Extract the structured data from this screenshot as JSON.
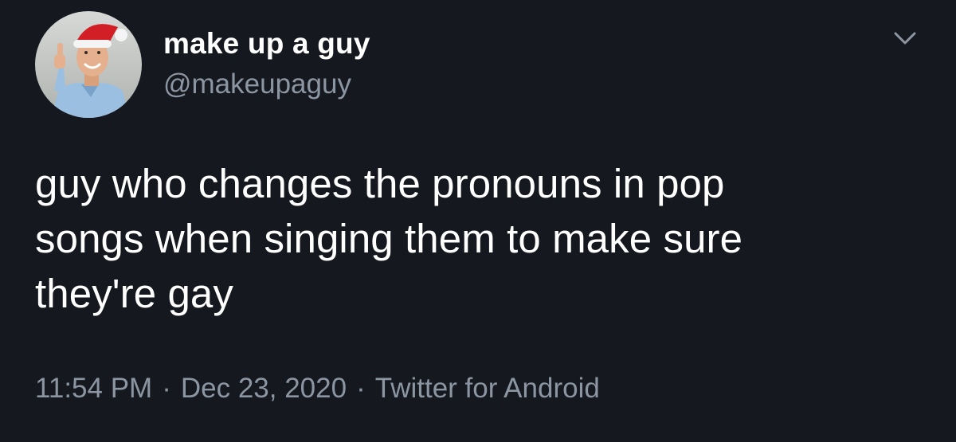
{
  "colors": {
    "background": "#15181f",
    "primary_text": "#ffffff",
    "secondary_text": "#8b96a2"
  },
  "author": {
    "display_name": "make up a guy",
    "handle": "@makeupaguy",
    "avatar_icon": "avatar-santa-hat-thumbs-up"
  },
  "tweet": {
    "lines": [
      "guy who changes the pronouns in pop",
      "songs when singing them to make sure",
      "they're gay"
    ]
  },
  "meta": {
    "time": "11:54 PM",
    "separator": "·",
    "date": "Dec 23, 2020",
    "source": "Twitter for Android"
  },
  "menu": {
    "icon": "chevron-down-icon"
  }
}
